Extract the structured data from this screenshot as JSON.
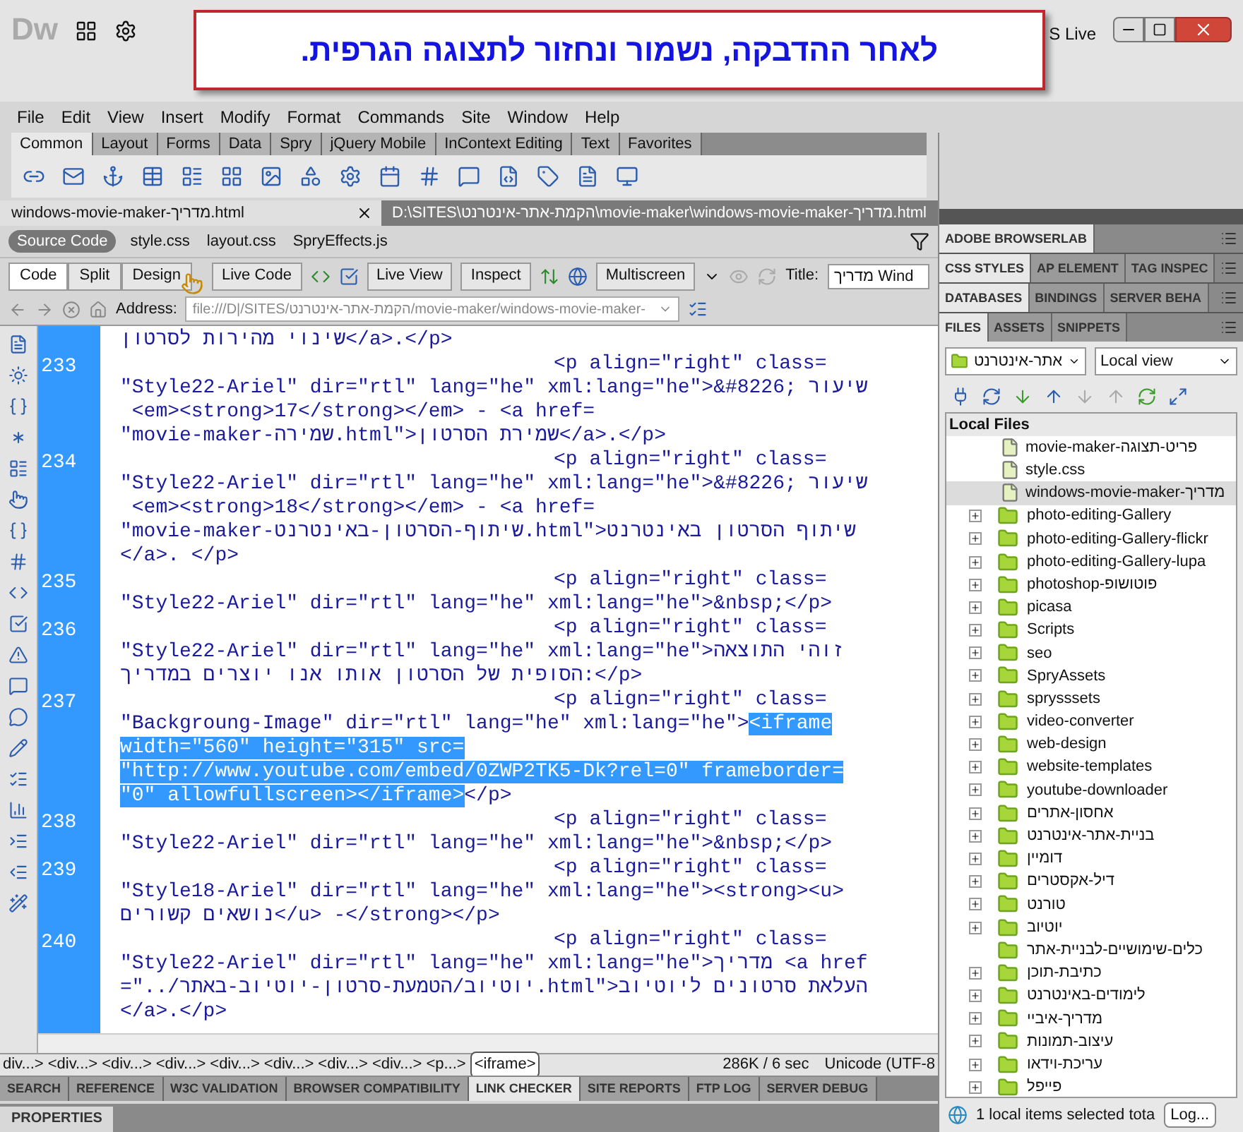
{
  "annotation": {
    "text": "לאחר ההדבקה, נשמור ונחזור לתצוגה הגרפית."
  },
  "window": {
    "logo": "Dw",
    "cs_live": "S Live"
  },
  "menu": [
    "File",
    "Edit",
    "View",
    "Insert",
    "Modify",
    "Format",
    "Commands",
    "Site",
    "Window",
    "Help"
  ],
  "insert_tabs": [
    {
      "label": "Common",
      "selected": true
    },
    {
      "label": "Layout",
      "selected": false
    },
    {
      "label": "Forms",
      "selected": false
    },
    {
      "label": "Data",
      "selected": false
    },
    {
      "label": "Spry",
      "selected": false
    },
    {
      "label": "jQuery Mobile",
      "selected": false
    },
    {
      "label": "InContext Editing",
      "selected": false
    },
    {
      "label": "Text",
      "selected": false
    },
    {
      "label": "Favorites",
      "selected": false
    }
  ],
  "document": {
    "tab": "windows-movie-maker-מדריך.html",
    "path": "D:\\SITES\\הקמת-אתר-אינטרנט\\movie-maker\\windows-movie-maker-מדריך.html"
  },
  "related_files": [
    {
      "label": "Source Code",
      "selected": true
    },
    {
      "label": "style.css",
      "selected": false
    },
    {
      "label": "layout.css",
      "selected": false
    },
    {
      "label": "SpryEffects.js",
      "selected": false
    }
  ],
  "view_buttons": [
    {
      "label": "Code",
      "selected": true
    },
    {
      "label": "Split",
      "selected": false
    },
    {
      "label": "Design",
      "selected": false
    }
  ],
  "live_buttons": [
    "Live Code",
    "Live View",
    "Inspect",
    "Multiscreen"
  ],
  "title_field": {
    "label": "Title:",
    "value": "מדריך Wind"
  },
  "address": {
    "label": "Address:",
    "value": "file:///D|/SITES/הקמת-אתר-אינטרנט/movie-maker/windows-movie-maker-"
  },
  "code": {
    "lines": [
      {
        "text": "שינוי מהירות לסרטון</a>.</p>"
      },
      {
        "num": "233",
        "indent": true,
        "text": "<p align=\"right\" class="
      },
      {
        "text": "\"Style22-Ariel\" dir=\"rtl\" lang=\"he\" xml:lang=\"he\">&#8226; שיעור"
      },
      {
        "text": " <em><strong>17</strong></em> - <a href="
      },
      {
        "text": "\"movie-maker-שמירה.html\">שמירת הסרטון</a>.</p>"
      },
      {
        "num": "234",
        "indent": true,
        "text": "<p align=\"right\" class="
      },
      {
        "text": "\"Style22-Ariel\" dir=\"rtl\" lang=\"he\" xml:lang=\"he\">&#8226; שיעור"
      },
      {
        "text": " <em><strong>18</strong></em> - <a href="
      },
      {
        "text": "\"movie-maker-שיתוף-הסרטון-באינטרנט.html\">שיתוף הסרטון באינטרנט"
      },
      {
        "text": "</a>. </p>"
      },
      {
        "num": "235",
        "indent": true,
        "text": "<p align=\"right\" class="
      },
      {
        "text": "\"Style22-Ariel\" dir=\"rtl\" lang=\"he\" xml:lang=\"he\">&nbsp;</p>"
      },
      {
        "num": "236",
        "indent": true,
        "text": "<p align=\"right\" class="
      },
      {
        "text": "\"Style22-Ariel\" dir=\"rtl\" lang=\"he\" xml:lang=\"he\">זוהי התוצאה"
      },
      {
        "text": "הסופית של הסרטון אותו אנו יוצרים במדריך:</p>"
      },
      {
        "num": "237",
        "indent": true,
        "text": "<p align=\"right\" class="
      },
      {
        "segments": [
          {
            "text": "\"Backgroung-Image\" dir=\"rtl\" lang=\"he\" xml:lang=\"he\">",
            "selected": false
          },
          {
            "text": "<iframe",
            "selected": true
          }
        ]
      },
      {
        "segments": [
          {
            "text": "width=\"560\" height=\"315\" src=",
            "selected": true
          }
        ]
      },
      {
        "segments": [
          {
            "text": "\"http://www.youtube.com/embed/0ZWP2TK5-Dk?rel=0\" frameborder=",
            "selected": true
          }
        ]
      },
      {
        "segments": [
          {
            "text": "\"0\" allowfullscreen></iframe>",
            "selected": true
          },
          {
            "text": "</p>",
            "selected": false
          }
        ]
      },
      {
        "num": "238",
        "indent": true,
        "text": "<p align=\"right\" class="
      },
      {
        "text": "\"Style22-Ariel\" dir=\"rtl\" lang=\"he\" xml:lang=\"he\">&nbsp;</p>"
      },
      {
        "num": "239",
        "indent": true,
        "text": "<p align=\"right\" class="
      },
      {
        "text": "\"Style18-Ariel\" dir=\"rtl\" lang=\"he\" xml:lang=\"he\"><strong><u>"
      },
      {
        "text": "נושאים קשורים</u> -</strong></p>"
      },
      {
        "num": "240",
        "indent": true,
        "text": "<p align=\"right\" class="
      },
      {
        "text": "\"Style22-Ariel\" dir=\"rtl\" lang=\"he\" xml:lang=\"he\">מדריך <a href"
      },
      {
        "text": "=\"../יוטיוב/הטמעת-סרטון-יוטיוב-באתר.html\">העלאת סרטונים ליוטיוב"
      },
      {
        "text": "</a>.</p>"
      }
    ]
  },
  "tag_selector": {
    "tags": [
      {
        "label": "div...>",
        "selected": false
      },
      {
        "label": "<div...>",
        "selected": false
      },
      {
        "label": "<div...>",
        "selected": false
      },
      {
        "label": "<div...>",
        "selected": false
      },
      {
        "label": "<div...>",
        "selected": false
      },
      {
        "label": "<div...>",
        "selected": false
      },
      {
        "label": "<div...>",
        "selected": false
      },
      {
        "label": "<div...>",
        "selected": false
      },
      {
        "label": "<p...>",
        "selected": false
      },
      {
        "label": "<iframe>",
        "selected": true
      }
    ],
    "stats": "286K / 6 sec",
    "encoding": "Unicode (UTF-8"
  },
  "bottom_tabs": [
    {
      "label": "SEARCH",
      "selected": false
    },
    {
      "label": "REFERENCE",
      "selected": false
    },
    {
      "label": "W3C VALIDATION",
      "selected": false
    },
    {
      "label": "BROWSER COMPATIBILITY",
      "selected": false
    },
    {
      "label": "LINK CHECKER",
      "selected": true
    },
    {
      "label": "SITE REPORTS",
      "selected": false
    },
    {
      "label": "FTP LOG",
      "selected": false
    },
    {
      "label": "SERVER DEBUG",
      "selected": false
    }
  ],
  "properties": {
    "label": "PROPERTIES"
  },
  "panel_groups": [
    [
      {
        "label": "ADOBE BROWSERLAB",
        "selected": true
      }
    ],
    [
      {
        "label": "CSS STYLES",
        "selected": true
      },
      {
        "label": "AP ELEMENT",
        "selected": false
      },
      {
        "label": "TAG INSPEC",
        "selected": false
      }
    ],
    [
      {
        "label": "DATABASES",
        "selected": true
      },
      {
        "label": "BINDINGS",
        "selected": false
      },
      {
        "label": "SERVER BEHA",
        "selected": false
      }
    ],
    [
      {
        "label": "FILES",
        "selected": true
      },
      {
        "label": "ASSETS",
        "selected": false
      },
      {
        "label": "SNIPPETS",
        "selected": false
      }
    ]
  ],
  "files": {
    "site": "אתר-אינטרנט",
    "view": "Local view",
    "header": "Local Files",
    "items": [
      {
        "kind": "file",
        "name": "movie-maker-פריט-תצוגה",
        "selected": false
      },
      {
        "kind": "file",
        "name": "style.css",
        "selected": false
      },
      {
        "kind": "file",
        "name": "windows-movie-maker-מדריך",
        "selected": true
      },
      {
        "kind": "folder",
        "name": "photo-editing-Gallery",
        "expandable": true
      },
      {
        "kind": "folder",
        "name": "photo-editing-Gallery-flickr",
        "expandable": true
      },
      {
        "kind": "folder",
        "name": "photo-editing-Gallery-lupa",
        "expandable": true
      },
      {
        "kind": "folder",
        "name": "photoshop-פוטושופ",
        "expandable": true
      },
      {
        "kind": "folder",
        "name": "picasa",
        "expandable": true
      },
      {
        "kind": "folder",
        "name": "Scripts",
        "expandable": true
      },
      {
        "kind": "folder",
        "name": "seo",
        "expandable": true
      },
      {
        "kind": "folder",
        "name": "SpryAssets",
        "expandable": true
      },
      {
        "kind": "folder",
        "name": "sprysssets",
        "expandable": true
      },
      {
        "kind": "folder",
        "name": "video-converter",
        "expandable": true
      },
      {
        "kind": "folder",
        "name": "web-design",
        "expandable": true
      },
      {
        "kind": "folder",
        "name": "website-templates",
        "expandable": true
      },
      {
        "kind": "folder",
        "name": "youtube-downloader",
        "expandable": true
      },
      {
        "kind": "folder",
        "name": "אחסון-אתרים",
        "expandable": true
      },
      {
        "kind": "folder",
        "name": "בניית-אתר-אינטרנט",
        "expandable": true
      },
      {
        "kind": "folder",
        "name": "דומיין",
        "expandable": true
      },
      {
        "kind": "folder",
        "name": "דיל-אקסטרים",
        "expandable": true
      },
      {
        "kind": "folder",
        "name": "טורנט",
        "expandable": true
      },
      {
        "kind": "folder",
        "name": "יוטיוב",
        "expandable": true
      },
      {
        "kind": "folder",
        "name": "כלים-שימושיים-לבניית-אתר",
        "expandable": false
      },
      {
        "kind": "folder",
        "name": "כתיבת-תוכן",
        "expandable": true
      },
      {
        "kind": "folder",
        "name": "לימודים-באינטרנט",
        "expandable": true
      },
      {
        "kind": "folder",
        "name": "מדריך-איביי",
        "expandable": true
      },
      {
        "kind": "folder",
        "name": "עיצוב-תמונות",
        "expandable": true
      },
      {
        "kind": "folder",
        "name": "עריכת-וידאו",
        "expandable": true
      },
      {
        "kind": "folder",
        "name": "פייפל",
        "expandable": true
      }
    ],
    "status": "1 local items selected tota",
    "log_button": "Log..."
  }
}
